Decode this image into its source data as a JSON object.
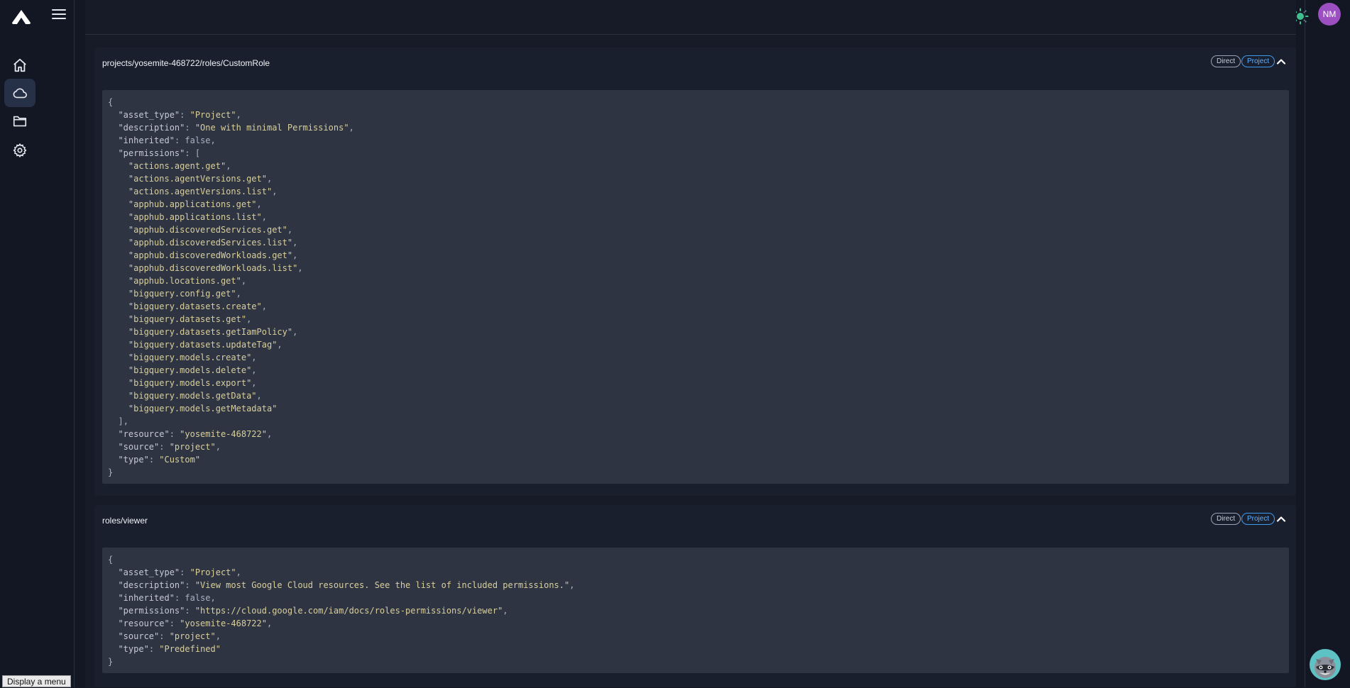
{
  "header": {
    "avatar_initials": "NM",
    "theme_icon": "sun-icon",
    "menu_icon": "hamburger-icon",
    "logo_icon": "mountain-logo-icon"
  },
  "sidenav": {
    "items": [
      {
        "name": "home",
        "icon": "home-icon"
      },
      {
        "name": "cloud",
        "icon": "cloud-icon"
      },
      {
        "name": "folder",
        "icon": "folder-icon"
      },
      {
        "name": "settings",
        "icon": "gear-icon"
      }
    ]
  },
  "panels": [
    {
      "title": "projects/yosemite-468722/roles/CustomRole",
      "badge_direct": "Direct",
      "badge_project": "Project",
      "json": {
        "asset_type": "Project",
        "description": "One with minimal Permissions",
        "inherited": "false",
        "permissions": [
          "actions.agent.get",
          "actions.agentVersions.get",
          "actions.agentVersions.list",
          "apphub.applications.get",
          "apphub.applications.list",
          "apphub.discoveredServices.get",
          "apphub.discoveredServices.list",
          "apphub.discoveredWorkloads.get",
          "apphub.discoveredWorkloads.list",
          "apphub.locations.get",
          "bigquery.config.get",
          "bigquery.datasets.create",
          "bigquery.datasets.get",
          "bigquery.datasets.getIamPolicy",
          "bigquery.datasets.updateTag",
          "bigquery.models.create",
          "bigquery.models.delete",
          "bigquery.models.export",
          "bigquery.models.getData",
          "bigquery.models.getMetadata"
        ],
        "resource": "yosemite-468722",
        "source": "project",
        "type": "Custom"
      }
    },
    {
      "title": "roles/viewer",
      "badge_direct": "Direct",
      "badge_project": "Project",
      "json": {
        "asset_type": "Project",
        "description": "View most Google Cloud resources. See the list of included permissions.",
        "inherited": "false",
        "permissions": "https://cloud.google.com/iam/docs/roles-permissions/viewer",
        "resource": "yosemite-468722",
        "source": "project",
        "type": "Predefined"
      }
    }
  ],
  "tooltip": "Display a menu",
  "colors": {
    "background": "#131724",
    "panel": "#1a1f2e",
    "code_bg": "#2e3442",
    "accent_blue": "#3d9bf0",
    "avatar": "#9b4fc0"
  }
}
